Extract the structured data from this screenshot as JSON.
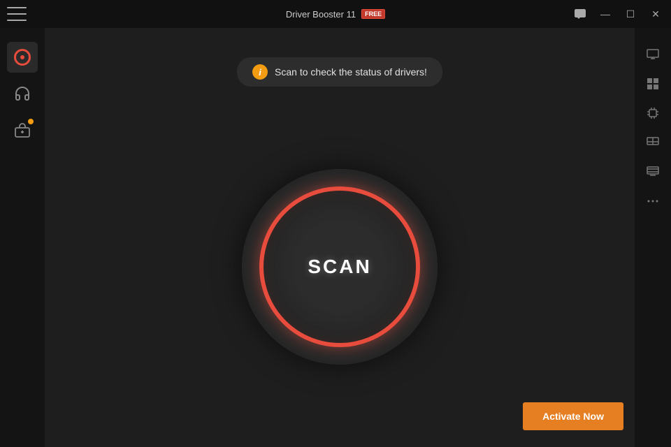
{
  "titleBar": {
    "appName": "Driver Booster 11",
    "badge": "FREE",
    "menuIcon": "hamburger-menu",
    "buttons": {
      "chat": "💬",
      "minimize": "—",
      "maximize": "☐",
      "close": "✕"
    }
  },
  "infoBanner": {
    "icon": "i",
    "text": "Scan to check the status of drivers!"
  },
  "scanButton": {
    "label": "SCAN"
  },
  "sidebar": {
    "items": [
      {
        "name": "driver-updater",
        "icon": "driver-icon",
        "active": true
      },
      {
        "name": "headset-support",
        "icon": "headset-icon",
        "active": false
      },
      {
        "name": "toolbox",
        "icon": "toolbox-icon",
        "active": false,
        "badge": true
      }
    ]
  },
  "rightPanel": {
    "items": [
      {
        "name": "monitor",
        "icon": "🖥"
      },
      {
        "name": "windows",
        "icon": "⊞"
      },
      {
        "name": "chip",
        "icon": "⬡"
      },
      {
        "name": "network",
        "icon": "⬜"
      },
      {
        "name": "display",
        "icon": "▦"
      },
      {
        "name": "more",
        "icon": "···"
      }
    ]
  },
  "activateButton": {
    "label": "Activate Now"
  }
}
